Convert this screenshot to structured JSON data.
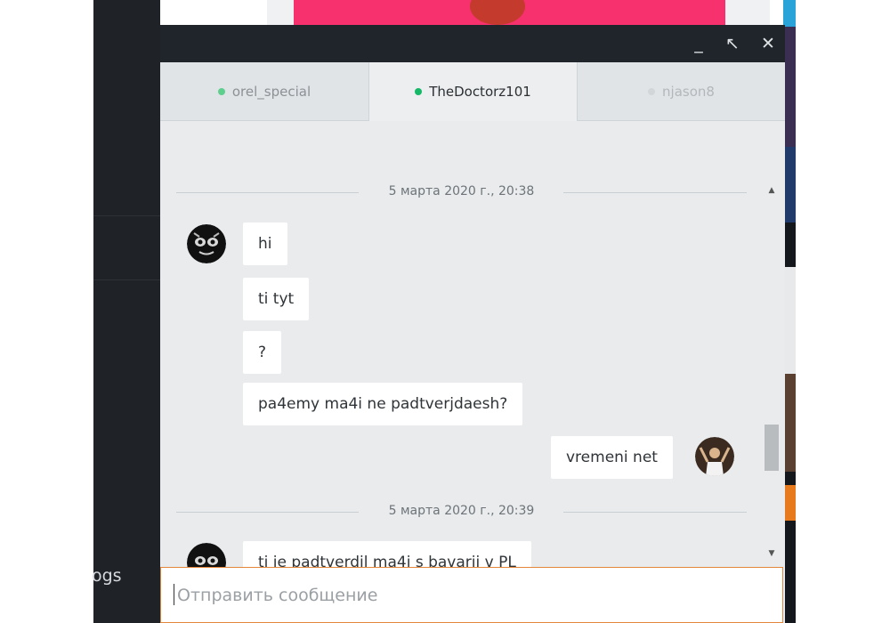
{
  "background": {
    "left_panel_text": "ogs"
  },
  "window": {
    "buttons": {
      "minimize": "_",
      "expand": "↖",
      "close": "✕"
    }
  },
  "tabs": [
    {
      "name": "orel_special",
      "status_color": "#5fcf8e",
      "active": false
    },
    {
      "name": "TheDoctorz101",
      "status_color": "#14b866",
      "active": true
    },
    {
      "name": "njason8",
      "status_color": "#c8ccd0",
      "active": false
    }
  ],
  "messages": {
    "date1": "5 марта 2020 г., 20:38",
    "in1": "hi",
    "in2": "ti tyt",
    "in3": "?",
    "in4": "pa4emy ma4i ne padtverjdaesh?",
    "out1": "vremeni net",
    "date2": "5 марта 2020 г., 20:39",
    "in5": "ti je padtverdil ma4i s bavarii v PL"
  },
  "input": {
    "placeholder": "Отправить сообщение",
    "value": ""
  },
  "colors": {
    "titlebar": "#20252b",
    "chat_bg": "#e9ebed",
    "input_border": "#e3873c",
    "online": "#14b866"
  }
}
